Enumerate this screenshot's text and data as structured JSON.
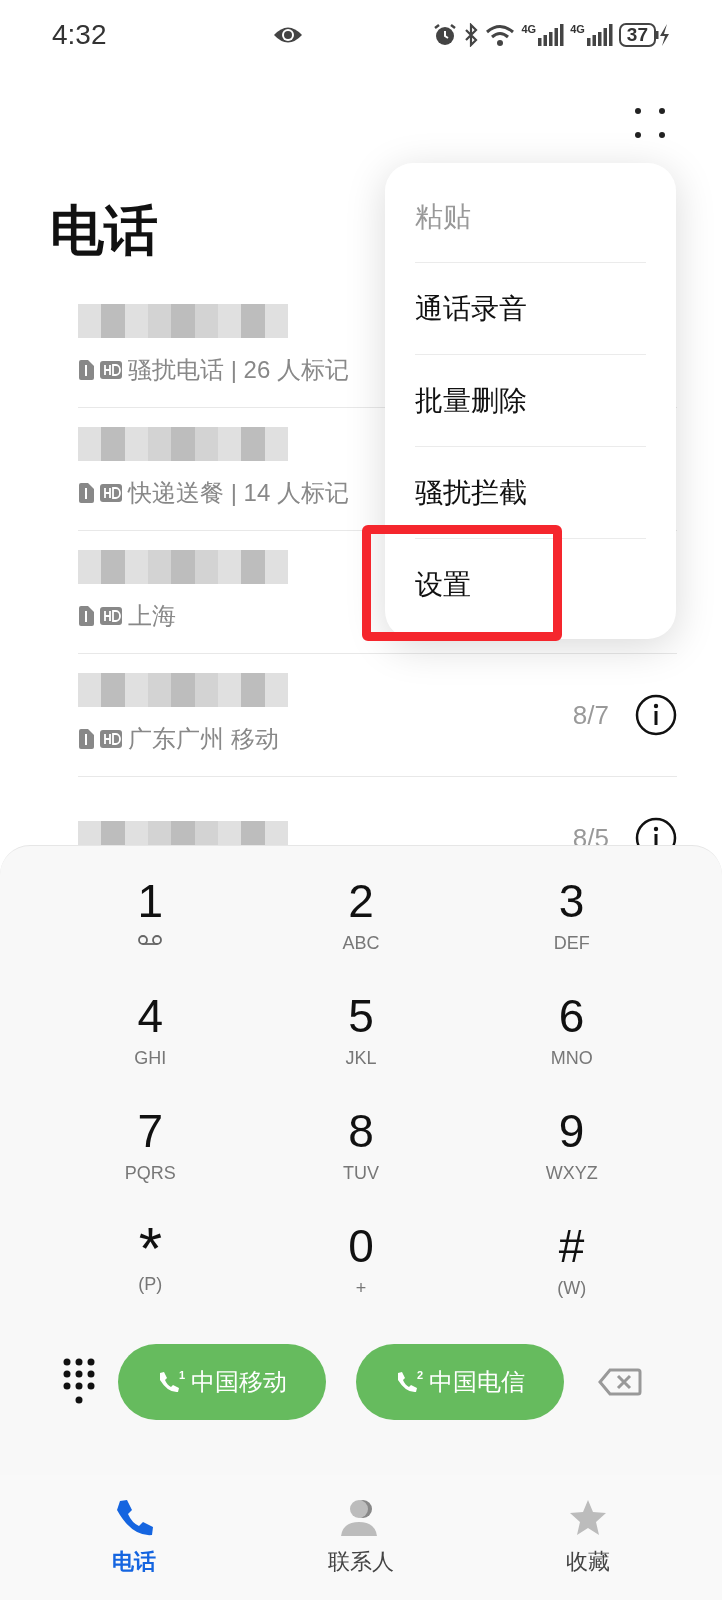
{
  "status_bar": {
    "time": "4:32",
    "network_labels": [
      "4G",
      "4G"
    ],
    "battery": "37"
  },
  "title": "电话",
  "calls": [
    {
      "subtitle": "骚扰电话 | 26 人标记"
    },
    {
      "subtitle": "快递送餐 | 14 人标记"
    },
    {
      "subtitle": "上海"
    },
    {
      "subtitle": "广东广州 移动",
      "date": "8/7"
    },
    {
      "date": "8/5"
    }
  ],
  "menu": [
    {
      "label": "粘贴",
      "disabled": true,
      "highlighted": false
    },
    {
      "label": "通话录音",
      "disabled": false,
      "highlighted": false
    },
    {
      "label": "批量删除",
      "disabled": false,
      "highlighted": false
    },
    {
      "label": "骚扰拦截",
      "disabled": false,
      "highlighted": false
    },
    {
      "label": "设置",
      "disabled": false,
      "highlighted": true
    }
  ],
  "keys": [
    {
      "digit": "1",
      "kind": "voicemail"
    },
    {
      "digit": "2",
      "letters": "ABC"
    },
    {
      "digit": "3",
      "letters": "DEF"
    },
    {
      "digit": "4",
      "letters": "GHI"
    },
    {
      "digit": "5",
      "letters": "JKL"
    },
    {
      "digit": "6",
      "letters": "MNO"
    },
    {
      "digit": "7",
      "letters": "PQRS"
    },
    {
      "digit": "8",
      "letters": "TUV"
    },
    {
      "digit": "9",
      "letters": "WXYZ"
    },
    {
      "digit": "*",
      "letters": "(P)"
    },
    {
      "digit": "0",
      "letters": "+"
    },
    {
      "digit": "#",
      "letters": "(W)"
    }
  ],
  "call_buttons": [
    {
      "sim": "1",
      "label": "中国移动"
    },
    {
      "sim": "2",
      "label": "中国电信"
    }
  ],
  "tabs": [
    {
      "label": "电话",
      "kind": "phone",
      "selected": true
    },
    {
      "label": "联系人",
      "kind": "contacts",
      "selected": false
    },
    {
      "label": "收藏",
      "kind": "star",
      "selected": false
    }
  ]
}
